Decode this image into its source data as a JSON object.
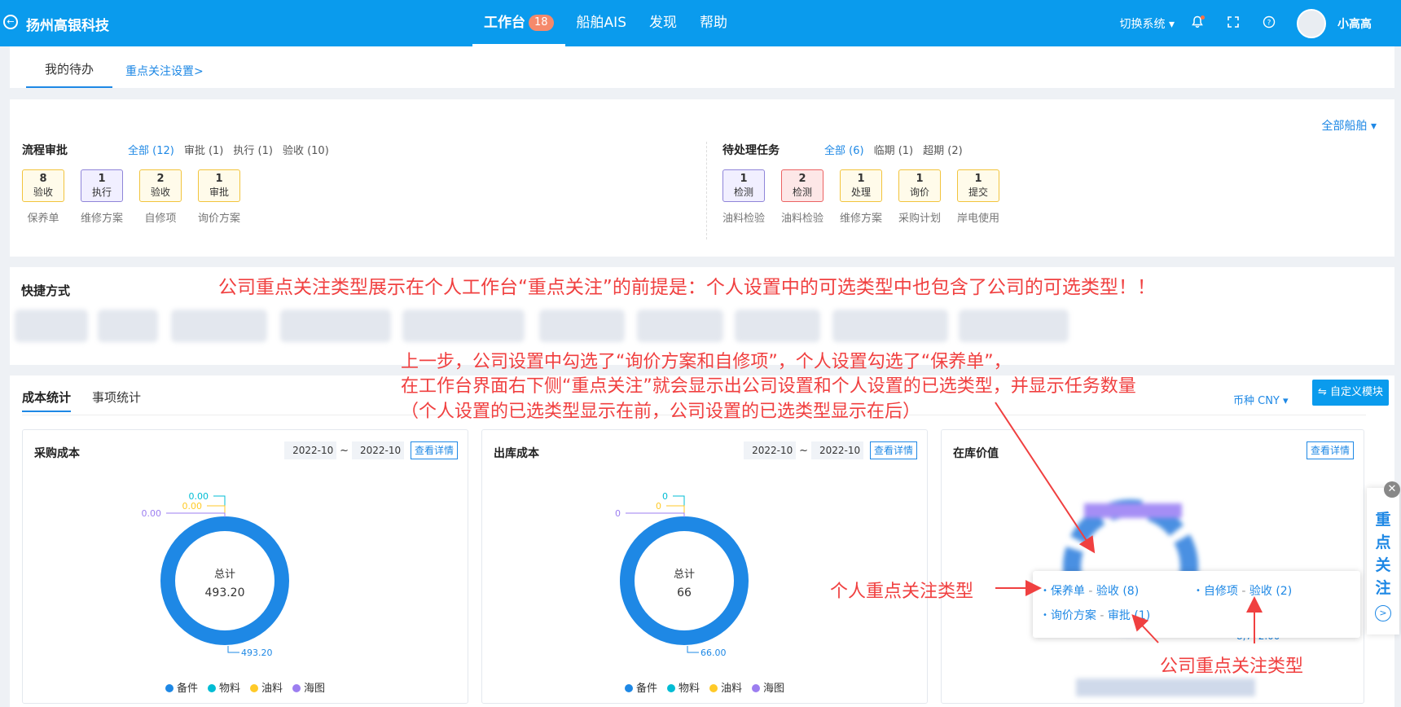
{
  "header": {
    "back_glyph": "←",
    "brand": "扬州高银科技",
    "nav": [
      {
        "label": "工作台",
        "badge": "18"
      },
      {
        "label": "船舶AIS"
      },
      {
        "label": "发现"
      },
      {
        "label": "帮助"
      }
    ],
    "switch_system": "切换系统 ▾",
    "user_name": "小高高"
  },
  "tabs": {
    "active": "我的待办",
    "link": "重点关注设置>"
  },
  "all_ships": "全部船舶 ▾",
  "process_approval": {
    "title": "流程审批",
    "filters": [
      "全部 (12)",
      "审批 (1)",
      "执行 (1)",
      "验收 (10)"
    ],
    "cards": [
      {
        "count": "8",
        "status": "验收",
        "label": "保养单",
        "color": "yellow"
      },
      {
        "count": "1",
        "status": "执行",
        "label": "维修方案",
        "color": "purple"
      },
      {
        "count": "2",
        "status": "验收",
        "label": "自修项",
        "color": "yellow"
      },
      {
        "count": "1",
        "status": "审批",
        "label": "询价方案",
        "color": "yellow"
      }
    ]
  },
  "pending_tasks": {
    "title": "待处理任务",
    "filters": [
      "全部 (6)",
      "临期 (1)",
      "超期 (2)"
    ],
    "cards": [
      {
        "count": "1",
        "status": "检测",
        "label": "油料检验",
        "color": "purple"
      },
      {
        "count": "2",
        "status": "检测",
        "label": "油料检验",
        "color": "red"
      },
      {
        "count": "1",
        "status": "处理",
        "label": "维修方案",
        "color": "yellow"
      },
      {
        "count": "1",
        "status": "询价",
        "label": "采购计划",
        "color": "yellow"
      },
      {
        "count": "1",
        "status": "提交",
        "label": "岸电使用",
        "color": "yellow"
      }
    ]
  },
  "shortcuts": {
    "title": "快捷方式"
  },
  "stats": {
    "tabs": [
      "成本统计",
      "事项统计"
    ],
    "currency": "币种 CNY ▾",
    "custom_button": "⇋ 自定义模块",
    "panels": [
      {
        "title": "采购成本",
        "date_from": "2022-10",
        "date_to": "2022-10",
        "tilde": "~",
        "detail": "查看详情",
        "center_label": "总计",
        "center_value": "493.20"
      },
      {
        "title": "出库成本",
        "date_from": "2022-10",
        "date_to": "2022-10",
        "tilde": "~",
        "detail": "查看详情",
        "center_label": "总计",
        "center_value": "66"
      },
      {
        "title": "在库价值",
        "detail": "查看详情",
        "visible_value": "8,772.00"
      }
    ]
  },
  "chart_data": [
    {
      "type": "pie",
      "title": "采购成本",
      "categories": [
        "备件",
        "物料",
        "油料",
        "海图"
      ],
      "values": [
        493.2,
        0.0,
        0.0,
        0.0
      ],
      "data_labels": [
        "493.20",
        "0.00",
        "0.00",
        "0.00"
      ],
      "colors": [
        "#1e88e5",
        "#00bcd4",
        "#ffca28",
        "#9c7ef0"
      ],
      "legend": "bottom",
      "donut": true
    },
    {
      "type": "pie",
      "title": "出库成本",
      "categories": [
        "备件",
        "物料",
        "油料",
        "海图"
      ],
      "values": [
        66.0,
        0,
        0,
        0
      ],
      "data_labels": [
        "66.00",
        "0",
        "0",
        "0"
      ],
      "colors": [
        "#1e88e5",
        "#00bcd4",
        "#ffca28",
        "#9c7ef0"
      ],
      "legend": "bottom",
      "donut": true
    }
  ],
  "focus_sidebar": {
    "title_chars": [
      "重",
      "点",
      "关",
      "注"
    ],
    "close": "✕",
    "go": ">"
  },
  "focus_popup": {
    "items": [
      {
        "type": "保养单",
        "action": "验收",
        "count": "(8)"
      },
      {
        "type": "自修项",
        "action": "验收",
        "count": "(2)"
      },
      {
        "type": "询价方案",
        "action": "审批",
        "count": "(1)"
      }
    ],
    "separator": "-"
  },
  "annotations": {
    "top": "公司重点关注类型展示在个人工作台“重点关注”的前提是：个人设置中的可选类型中也包含了公司的可选类型！！",
    "line1": "上一步，公司设置中勾选了“询价方案和自修项”，个人设置勾选了“保养单”，",
    "line2": "在工作台界面右下侧“重点关注”就会显示出公司设置和个人设置的已选类型，并显示任务数量",
    "line3": "（个人设置的已选类型显示在前，公司设置的已选类型显示在后）",
    "personal": "个人重点关注类型",
    "company": "公司重点关注类型"
  },
  "colors": {
    "topbar": "#0a9bed",
    "accent": "#1e88e5",
    "annotation": "#f04040"
  }
}
